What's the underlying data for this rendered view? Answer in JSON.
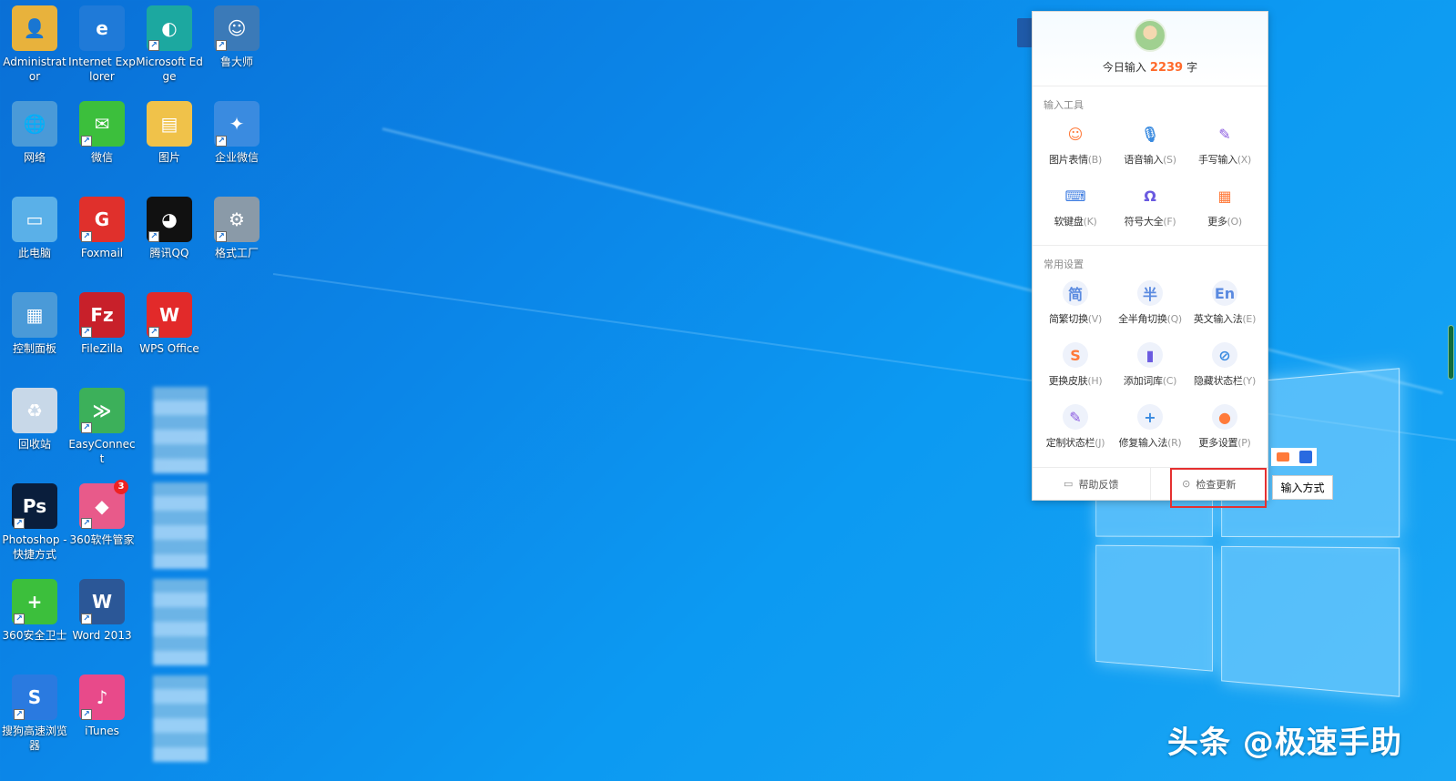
{
  "desktop": {
    "icons": [
      {
        "label": "Administrator",
        "icon": "user-folder-icon",
        "color": "#e8b23c"
      },
      {
        "label": "Internet Explorer",
        "icon": "ie-icon",
        "color": "#1f7ad8"
      },
      {
        "label": "Microsoft Edge",
        "icon": "edge-icon",
        "color": "#1ca8a0"
      },
      {
        "label": "鲁大师",
        "icon": "ludashi-icon",
        "color": "#3b7ab8"
      },
      {
        "label": "网络",
        "icon": "network-icon",
        "color": "#4a9ad8"
      },
      {
        "label": "微信",
        "icon": "wechat-icon",
        "color": "#3cbf3c"
      },
      {
        "label": "图片",
        "icon": "pictures-folder-icon",
        "color": "#f0c24a"
      },
      {
        "label": "企业微信",
        "icon": "wework-icon",
        "color": "#3a8be0"
      },
      {
        "label": "此电脑",
        "icon": "computer-icon",
        "color": "#5ab0e8"
      },
      {
        "label": "Foxmail",
        "icon": "foxmail-icon",
        "color": "#e0302c"
      },
      {
        "label": "腾讯QQ",
        "icon": "qq-icon",
        "color": "#111111"
      },
      {
        "label": "格式工厂",
        "icon": "format-factory-icon",
        "color": "#8a9aa8"
      },
      {
        "label": "控制面板",
        "icon": "control-panel-icon",
        "color": "#4a9ad8"
      },
      {
        "label": "FileZilla",
        "icon": "filezilla-icon",
        "color": "#c8202a"
      },
      {
        "label": "WPS Office",
        "icon": "wps-icon",
        "color": "#e22a2a"
      },
      {
        "label": "回收站",
        "icon": "recycle-bin-icon",
        "color": "#c8d8e8"
      },
      {
        "label": "EasyConnect",
        "icon": "easyconnect-icon",
        "color": "#3cb05a"
      },
      {
        "label": "Photoshop - 快捷方式",
        "icon": "photoshop-icon",
        "color": "#0a1e3c"
      },
      {
        "label": "360软件管家",
        "icon": "360-software-icon",
        "color": "#e85a8a"
      },
      {
        "label": "360安全卫士",
        "icon": "360-safe-icon",
        "color": "#3cbf3c"
      },
      {
        "label": "Word 2013",
        "icon": "word-icon",
        "color": "#2b5797"
      },
      {
        "label": "搜狗高速浏览器",
        "icon": "sogou-browser-icon",
        "color": "#2a7ae0"
      },
      {
        "label": "iTunes",
        "icon": "itunes-icon",
        "color": "#e84a8a"
      }
    ],
    "badge_360": "3"
  },
  "ime_panel": {
    "today_prefix": "今日输入",
    "today_count": "2239",
    "today_suffix": "字",
    "section_tools": "输入工具",
    "tools": [
      {
        "label": "图片表情",
        "key": "(B)",
        "icon": "emoji-icon",
        "color": "#ff7a3a"
      },
      {
        "label": "语音输入",
        "key": "(S)",
        "icon": "microphone-icon",
        "color": "#3a8be0"
      },
      {
        "label": "手写输入",
        "key": "(X)",
        "icon": "pen-icon",
        "color": "#8a5ae0"
      },
      {
        "label": "软键盘",
        "key": "(K)",
        "icon": "keyboard-icon",
        "color": "#3a7ae0"
      },
      {
        "label": "符号大全",
        "key": "(F)",
        "icon": "omega-icon",
        "color": "#6a5ae0"
      },
      {
        "label": "更多",
        "key": "(O)",
        "icon": "more-grid-icon",
        "color": "#ff7a3a"
      }
    ],
    "section_settings": "常用设置",
    "settings": [
      {
        "label": "简繁切换",
        "key": "(V)",
        "icon": "simplified-icon",
        "glyph": "简",
        "color": "#5a8ae0"
      },
      {
        "label": "全半角切换",
        "key": "(Q)",
        "icon": "halfwidth-icon",
        "glyph": "半",
        "color": "#5a8ae0"
      },
      {
        "label": "英文输入法",
        "key": "(E)",
        "icon": "english-icon",
        "glyph": "En",
        "color": "#5a8ae0"
      },
      {
        "label": "更换皮肤",
        "key": "(H)",
        "icon": "skin-icon",
        "glyph": "S",
        "color": "#ff7a3a"
      },
      {
        "label": "添加词库",
        "key": "(C)",
        "icon": "dictionary-icon",
        "glyph": "▮",
        "color": "#6a5ae0"
      },
      {
        "label": "隐藏状态栏",
        "key": "(Y)",
        "icon": "hide-eye-icon",
        "glyph": "⊘",
        "color": "#3a8be0"
      },
      {
        "label": "定制状态栏",
        "key": "(J)",
        "icon": "customize-icon",
        "glyph": "✎",
        "color": "#8a5ae0"
      },
      {
        "label": "修复输入法",
        "key": "(R)",
        "icon": "repair-icon",
        "glyph": "+",
        "color": "#3a8be0"
      },
      {
        "label": "更多设置",
        "key": "(P)",
        "icon": "settings-hex-icon",
        "glyph": "●",
        "color": "#ff7a3a"
      }
    ],
    "footer": {
      "help": "帮助反馈",
      "update": "检查更新"
    }
  },
  "ime_bar": {
    "button": "输入方式"
  },
  "watermark": "头条 @极速手助"
}
